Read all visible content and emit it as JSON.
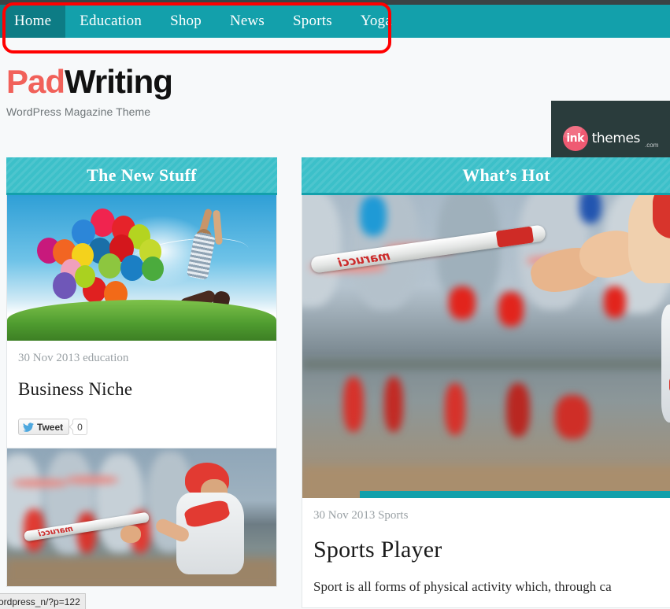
{
  "nav": {
    "items": [
      {
        "label": "Home",
        "active": true
      },
      {
        "label": "Education",
        "active": false
      },
      {
        "label": "Shop",
        "active": false
      },
      {
        "label": "News",
        "active": false
      },
      {
        "label": "Sports",
        "active": false
      },
      {
        "label": "Yoga",
        "active": false
      }
    ]
  },
  "brand": {
    "part1": "Pad",
    "part2": "Writing",
    "tagline": "WordPress Magazine Theme",
    "accent_color": "#f1615a"
  },
  "ad": {
    "mark": "ink",
    "word": "themes",
    "tld": ".com",
    "background": "#2a3c3c",
    "circle_color": "#ef5a72"
  },
  "sections": {
    "left": {
      "heading": "The New Stuff"
    },
    "right": {
      "heading": "What’s Hot"
    },
    "accent_color": "#13a0ab",
    "heading_background": "#3cc0c9"
  },
  "posts": {
    "left": [
      {
        "image": "balloons-jumping-person-photo",
        "meta": "30 Nov 2013 education",
        "title": "Business Niche",
        "tweet_label": "Tweet",
        "tweet_count": "0"
      },
      {
        "image": "baseball-player-swinging-bat-photo"
      }
    ],
    "right": [
      {
        "image": "baseball-bat-closeup-photo",
        "meta": "30 Nov 2013 Sports",
        "title": "Sports Player",
        "excerpt": "Sport is all forms of physical activity which, through ca"
      }
    ]
  },
  "annotation": {
    "shape": "rounded-rectangle",
    "color": "#ff0000",
    "target": "primary-navigation-menu"
  },
  "status_bar": {
    "url": "ordpress_n/?p=122"
  }
}
